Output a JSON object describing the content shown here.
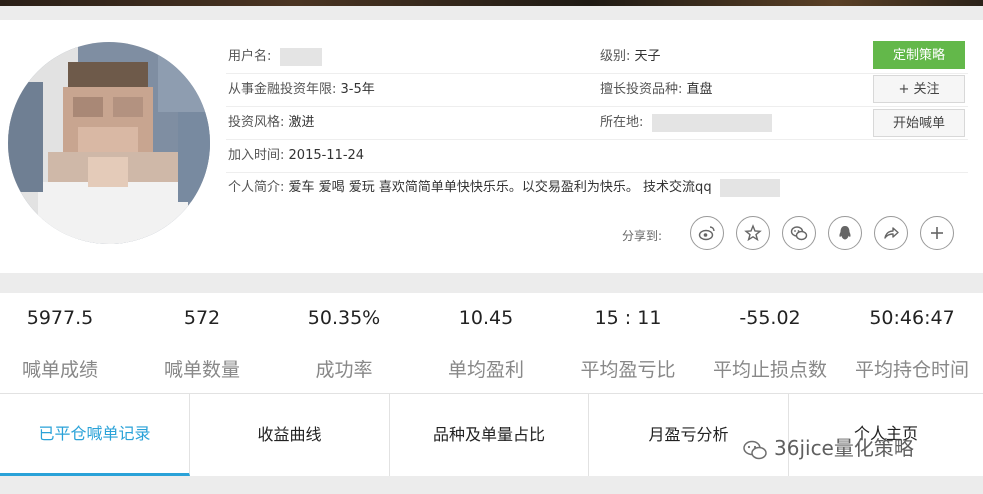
{
  "profile": {
    "username_label": "用户名:",
    "level_label": "级别:",
    "level_value": "天子",
    "years_label": "从事金融投资年限:",
    "years_value": "3-5年",
    "specialty_label": "擅长投资品种:",
    "specialty_value": "直盘",
    "style_label": "投资风格:",
    "style_value": "激进",
    "location_label": "所在地:",
    "joined_label": "加入时间:",
    "joined_value": "2015-11-24",
    "bio_label": "个人简介:",
    "bio_value": "爱车 爱喝 爱玩 喜欢简简单单快快乐乐。以交易盈利为快乐。 技术交流qq"
  },
  "buttons": {
    "custom_strategy": "定制策略",
    "follow": "+ 关注",
    "start_call": "开始喊单"
  },
  "share": {
    "label": "分享到:",
    "icons": [
      "weibo-icon",
      "star-icon",
      "wechat-icon",
      "qq-icon",
      "share-arrow-icon",
      "plus-icon"
    ]
  },
  "stats": [
    {
      "value": "5977.5",
      "label": "喊单成绩"
    },
    {
      "value": "572",
      "label": "喊单数量"
    },
    {
      "value": "50.35%",
      "label": "成功率"
    },
    {
      "value": "10.45",
      "label": "单均盈利"
    },
    {
      "value": "15 : 11",
      "label": "平均盈亏比"
    },
    {
      "value": "-55.02",
      "label": "平均止损点数"
    },
    {
      "value": "50:46:47",
      "label": "平均持仓时间"
    }
  ],
  "tabs": [
    {
      "label": "已平仓喊单记录"
    },
    {
      "label": "收益曲线"
    },
    {
      "label": "品种及单量占比"
    },
    {
      "label": "月盈亏分析"
    },
    {
      "label": "个人主页"
    }
  ],
  "watermark": "36jice量化策略",
  "colors": {
    "accent_green": "#63b84a",
    "active_tab": "#2aa2d8"
  }
}
